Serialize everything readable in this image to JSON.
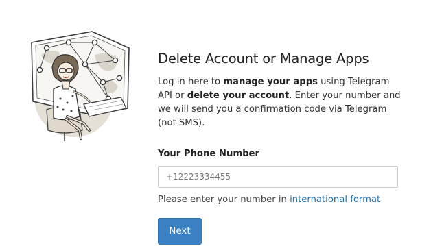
{
  "header": {
    "title": "Delete Account or Manage Apps"
  },
  "description": {
    "part1": "Log in here to ",
    "bold1": "manage your apps",
    "part2": " using Telegram API or ",
    "bold2": "delete your account",
    "part3": ". Enter your number and we will send you a confirmation code via Telegram (not SMS)."
  },
  "form": {
    "phone_label": "Your Phone Number",
    "phone_placeholder": "+12223334455",
    "phone_value": "",
    "hint_text": "Please enter your number in ",
    "hint_link": "international format",
    "next_label": "Next"
  },
  "colors": {
    "button": "#3a81c4",
    "link": "#2a6fa5",
    "illustration_bg": "#e8e3d8"
  },
  "icons": {
    "illustration": "telegram-developer-illustration"
  }
}
